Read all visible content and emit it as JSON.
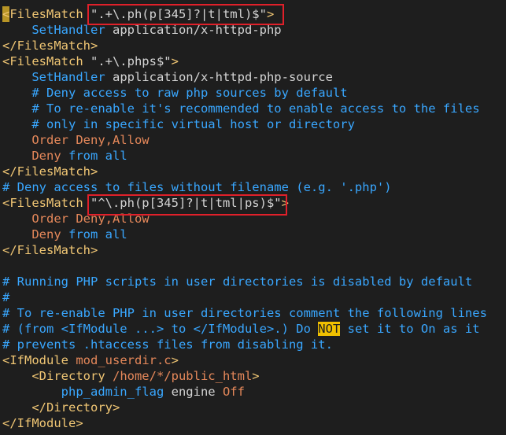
{
  "lines": [
    {
      "segments": [
        {
          "c": "tag",
          "t": "<FilesMatch "
        },
        {
          "c": "str",
          "t": "\".+\\.ph(p[345]?|t|tml)$\""
        },
        {
          "c": "tag",
          "t": ">"
        }
      ]
    },
    {
      "segments": [
        {
          "c": "kw",
          "t": "    SetHandler "
        },
        {
          "c": "val",
          "t": "application/x-httpd-php"
        }
      ]
    },
    {
      "segments": [
        {
          "c": "tag",
          "t": "</FilesMatch>"
        }
      ]
    },
    {
      "segments": [
        {
          "c": "tag",
          "t": "<FilesMatch "
        },
        {
          "c": "str",
          "t": "\".+\\.phps$\""
        },
        {
          "c": "tag",
          "t": ">"
        }
      ]
    },
    {
      "segments": [
        {
          "c": "kw",
          "t": "    SetHandler "
        },
        {
          "c": "val",
          "t": "application/x-httpd-php-source"
        }
      ]
    },
    {
      "segments": [
        {
          "c": "cmt",
          "t": "    # Deny access to raw php sources by default"
        }
      ]
    },
    {
      "segments": [
        {
          "c": "cmt",
          "t": "    # To re-enable it's recommended to enable access to the files"
        }
      ]
    },
    {
      "segments": [
        {
          "c": "cmt",
          "t": "    # only in specific virtual host or directory"
        }
      ]
    },
    {
      "segments": [
        {
          "c": "ord",
          "t": "    Order Deny,Allow"
        }
      ]
    },
    {
      "segments": [
        {
          "c": "ord",
          "t": "    Deny "
        },
        {
          "c": "kw",
          "t": "from "
        },
        {
          "c": "all",
          "t": "all"
        }
      ]
    },
    {
      "segments": [
        {
          "c": "tag",
          "t": "</FilesMatch>"
        }
      ]
    },
    {
      "segments": [
        {
          "c": "cmt",
          "t": "# Deny access to files without filename (e.g. '.php')"
        }
      ]
    },
    {
      "segments": [
        {
          "c": "tag",
          "t": "<FilesMatch "
        },
        {
          "c": "str",
          "t": "\"^\\.ph(p[345]?|t|tml|ps)$\""
        },
        {
          "c": "tag",
          "t": ">"
        }
      ]
    },
    {
      "segments": [
        {
          "c": "ord",
          "t": "    Order Deny,Allow"
        }
      ]
    },
    {
      "segments": [
        {
          "c": "ord",
          "t": "    Deny "
        },
        {
          "c": "kw",
          "t": "from "
        },
        {
          "c": "all",
          "t": "all"
        }
      ]
    },
    {
      "segments": [
        {
          "c": "tag",
          "t": "</FilesMatch>"
        }
      ]
    },
    {
      "segments": []
    },
    {
      "segments": [
        {
          "c": "cmt",
          "t": "# Running PHP scripts in user directories is disabled by default"
        }
      ]
    },
    {
      "segments": [
        {
          "c": "cmt",
          "t": "#"
        }
      ]
    },
    {
      "segments": [
        {
          "c": "cmt",
          "t": "# To re-enable PHP in user directories comment the following lines"
        }
      ]
    },
    {
      "segments": [
        {
          "c": "cmt",
          "t": "# (from <IfModule ...> to </IfModule>.) Do "
        },
        {
          "c": "hl",
          "t": "NOT"
        },
        {
          "c": "cmt",
          "t": " set it to On as it"
        }
      ]
    },
    {
      "segments": [
        {
          "c": "cmt",
          "t": "# prevents .htaccess files from disabling it."
        }
      ]
    },
    {
      "segments": [
        {
          "c": "tag",
          "t": "<IfModule "
        },
        {
          "c": "mod",
          "t": "mod_userdir.c"
        },
        {
          "c": "tag",
          "t": ">"
        }
      ]
    },
    {
      "segments": [
        {
          "c": "dir",
          "t": "    <Directory "
        },
        {
          "c": "path",
          "t": "/home/*/public_html"
        },
        {
          "c": "dir",
          "t": ">"
        }
      ]
    },
    {
      "segments": [
        {
          "c": "kw",
          "t": "        php_admin_flag "
        },
        {
          "c": "val",
          "t": "engine "
        },
        {
          "c": "off",
          "t": "Off"
        }
      ]
    },
    {
      "segments": [
        {
          "c": "dir",
          "t": "    </Directory>"
        }
      ]
    },
    {
      "segments": [
        {
          "c": "tag",
          "t": "</IfModule>"
        }
      ]
    }
  ]
}
